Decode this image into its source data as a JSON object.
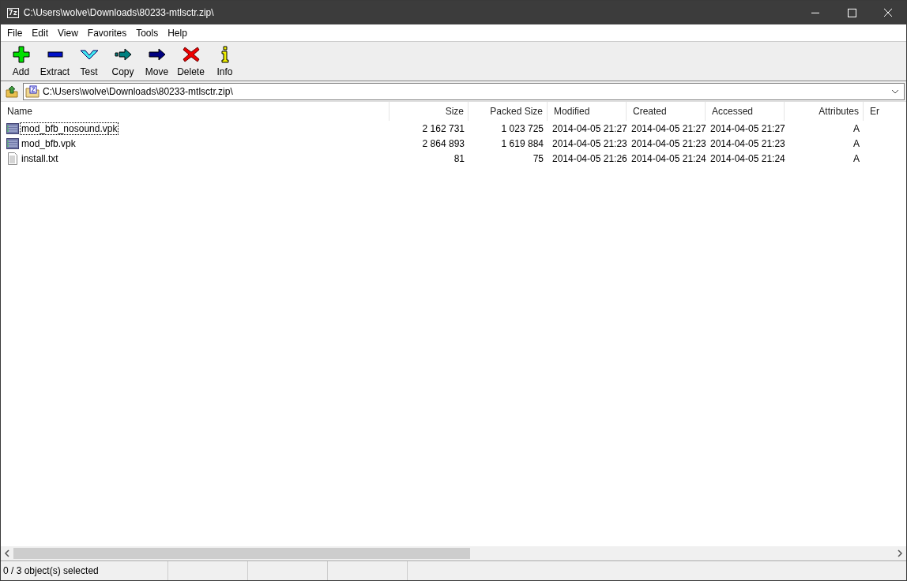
{
  "window": {
    "title": "C:\\Users\\wolve\\Downloads\\80233-mtlsctr.zip\\",
    "app_icon": "7z"
  },
  "menu": [
    "File",
    "Edit",
    "View",
    "Favorites",
    "Tools",
    "Help"
  ],
  "toolbar": [
    {
      "label": "Add",
      "kind": "add"
    },
    {
      "label": "Extract",
      "kind": "extract"
    },
    {
      "label": "Test",
      "kind": "test"
    },
    {
      "label": "Copy",
      "kind": "copy"
    },
    {
      "label": "Move",
      "kind": "move"
    },
    {
      "label": "Delete",
      "kind": "delete"
    },
    {
      "label": "Info",
      "kind": "info"
    }
  ],
  "address": {
    "value": "C:\\Users\\wolve\\Downloads\\80233-mtlsctr.zip\\"
  },
  "table": {
    "columns": [
      "Name",
      "Size",
      "Packed Size",
      "Modified",
      "Created",
      "Accessed",
      "Attributes",
      "Er"
    ],
    "rows": [
      {
        "kind": "archive",
        "focused": true,
        "selected": false,
        "cells": [
          "mod_bfb_nosound.vpk",
          "2 162 731",
          "1 023 725",
          "2014-04-05 21:27",
          "2014-04-05 21:27",
          "2014-04-05 21:27",
          "A"
        ]
      },
      {
        "kind": "archive",
        "focused": false,
        "selected": false,
        "cells": [
          "mod_bfb.vpk",
          "2 864 893",
          "1 619 884",
          "2014-04-05 21:23",
          "2014-04-05 21:23",
          "2014-04-05 21:23",
          "A"
        ]
      },
      {
        "kind": "text",
        "focused": false,
        "selected": false,
        "cells": [
          "install.txt",
          "81",
          "75",
          "2014-04-05 21:26",
          "2014-04-05 21:24",
          "2014-04-05 21:24",
          "A"
        ]
      }
    ]
  },
  "status_bar": [
    "0 / 3 object(s) selected"
  ]
}
